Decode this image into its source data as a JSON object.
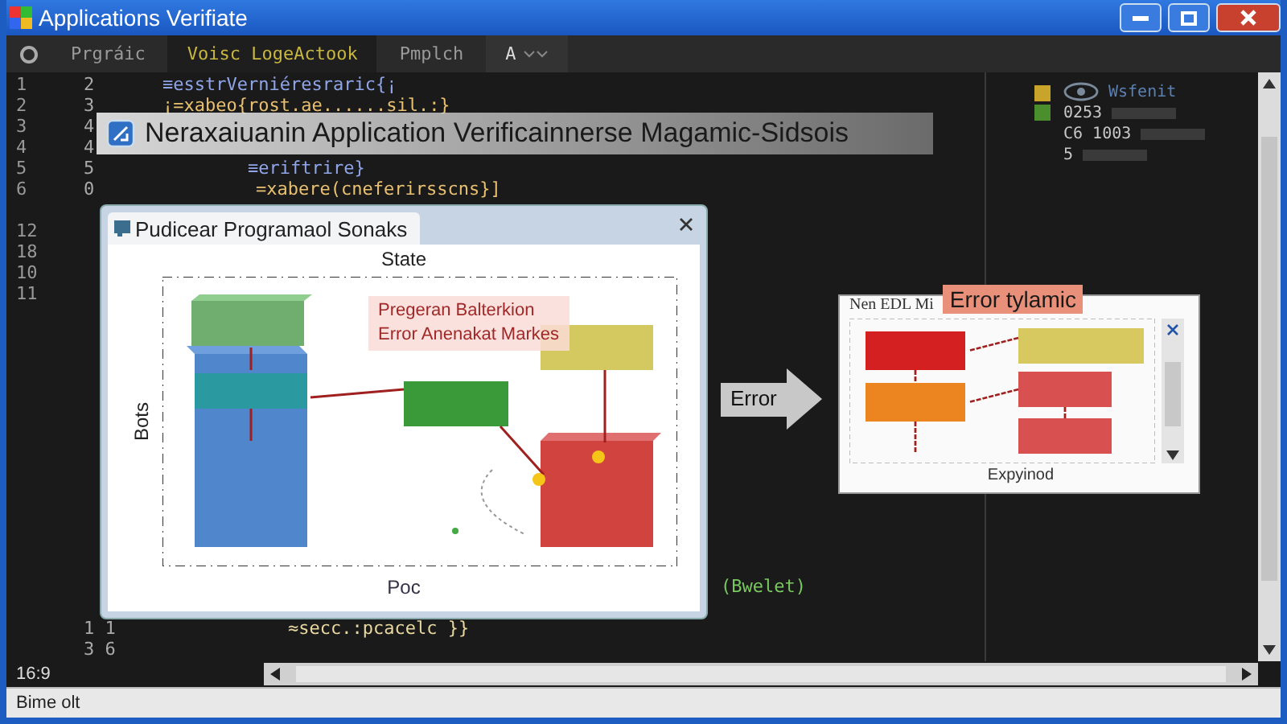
{
  "window": {
    "title": "Applications Verifiate"
  },
  "tabs": [
    {
      "label": "Prgráic",
      "selected": false,
      "kind": "tab"
    },
    {
      "label": "Voisc LogeActook",
      "selected": true,
      "kind": "tab"
    },
    {
      "label": "Pmplch",
      "selected": false,
      "kind": "tab"
    },
    {
      "label": "A",
      "selected": false,
      "kind": "dropdown"
    }
  ],
  "editor_rows": [
    {
      "gutter_1": "1",
      "gutter_2": "2",
      "code": "≡esstrVerniéresraric{¡"
    },
    {
      "gutter_1": "2",
      "gutter_2": "3",
      "code": "¡=xabeo{rost.ae......sil.:}"
    },
    {
      "gutter_1": "3",
      "gutter_2": "4"
    },
    {
      "gutter_1": "4",
      "gutter_2": "4"
    },
    {
      "gutter_1": "5",
      "gutter_2": "5",
      "code": "≡eriftrire}"
    },
    {
      "gutter_1": "6",
      "gutter_2": "0",
      "code": "=xabere(cneferirsscns}]"
    },
    {
      "gutter_1": "12"
    },
    {
      "gutter_1": "18"
    },
    {
      "gutter_1": "10"
    },
    {
      "gutter_1": "11"
    },
    {
      "code": "(Bwelet)"
    },
    {
      "gutter_2": "1 1",
      "code": "≈secc.:pcacelc }}"
    },
    {
      "gutter_2": "3 6"
    }
  ],
  "side_panel": {
    "items": [
      "Wsfenit",
      "0253",
      "C6 1003",
      "5"
    ]
  },
  "banner": {
    "title": "Neraxaiuanin Application Verificainnerse Magamic-Sidsois"
  },
  "dialog": {
    "title": "Pudicear Programaol Sonaks",
    "chart_title": "State",
    "y_label": "Bots",
    "x_label": "Poc",
    "annotation": [
      "Pregeran Balterkion",
      "Error Anenakat Markes"
    ]
  },
  "arrow_label": "Error",
  "error_panel": {
    "header": "Nen EDL Mi",
    "tag": "Error tylamic",
    "caption": "Expyinod"
  },
  "position": "16:9",
  "status_bar": {
    "text": "Bime olt"
  }
}
